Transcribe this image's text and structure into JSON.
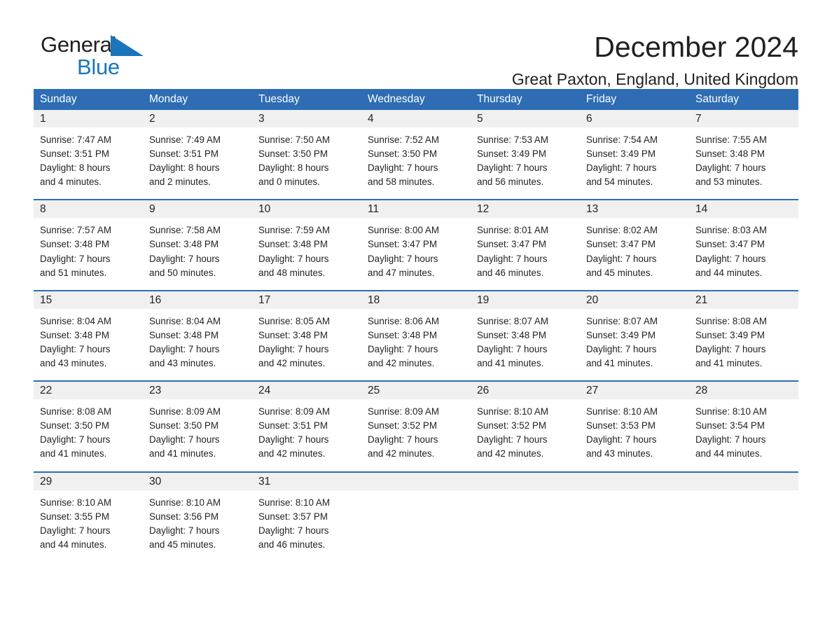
{
  "brand": {
    "name_part1": "General",
    "name_part2": "Blue",
    "triangle_color": "#1b75bb",
    "blue": "#1b75bb"
  },
  "header": {
    "title": "December 2024",
    "subtitle": "Great Paxton, England, United Kingdom"
  },
  "theme": {
    "header_blue": "#2e6db4",
    "daynum_band": "#f0f0f0",
    "text": "#231f20"
  },
  "calendar": {
    "weekdays": [
      "Sunday",
      "Monday",
      "Tuesday",
      "Wednesday",
      "Thursday",
      "Friday",
      "Saturday"
    ],
    "weeks": [
      [
        {
          "day": "1",
          "lines": [
            "Sunrise: 7:47 AM",
            "Sunset: 3:51 PM",
            "Daylight: 8 hours",
            "and 4 minutes."
          ]
        },
        {
          "day": "2",
          "lines": [
            "Sunrise: 7:49 AM",
            "Sunset: 3:51 PM",
            "Daylight: 8 hours",
            "and 2 minutes."
          ]
        },
        {
          "day": "3",
          "lines": [
            "Sunrise: 7:50 AM",
            "Sunset: 3:50 PM",
            "Daylight: 8 hours",
            "and 0 minutes."
          ]
        },
        {
          "day": "4",
          "lines": [
            "Sunrise: 7:52 AM",
            "Sunset: 3:50 PM",
            "Daylight: 7 hours",
            "and 58 minutes."
          ]
        },
        {
          "day": "5",
          "lines": [
            "Sunrise: 7:53 AM",
            "Sunset: 3:49 PM",
            "Daylight: 7 hours",
            "and 56 minutes."
          ]
        },
        {
          "day": "6",
          "lines": [
            "Sunrise: 7:54 AM",
            "Sunset: 3:49 PM",
            "Daylight: 7 hours",
            "and 54 minutes."
          ]
        },
        {
          "day": "7",
          "lines": [
            "Sunrise: 7:55 AM",
            "Sunset: 3:48 PM",
            "Daylight: 7 hours",
            "and 53 minutes."
          ]
        }
      ],
      [
        {
          "day": "8",
          "lines": [
            "Sunrise: 7:57 AM",
            "Sunset: 3:48 PM",
            "Daylight: 7 hours",
            "and 51 minutes."
          ]
        },
        {
          "day": "9",
          "lines": [
            "Sunrise: 7:58 AM",
            "Sunset: 3:48 PM",
            "Daylight: 7 hours",
            "and 50 minutes."
          ]
        },
        {
          "day": "10",
          "lines": [
            "Sunrise: 7:59 AM",
            "Sunset: 3:48 PM",
            "Daylight: 7 hours",
            "and 48 minutes."
          ]
        },
        {
          "day": "11",
          "lines": [
            "Sunrise: 8:00 AM",
            "Sunset: 3:47 PM",
            "Daylight: 7 hours",
            "and 47 minutes."
          ]
        },
        {
          "day": "12",
          "lines": [
            "Sunrise: 8:01 AM",
            "Sunset: 3:47 PM",
            "Daylight: 7 hours",
            "and 46 minutes."
          ]
        },
        {
          "day": "13",
          "lines": [
            "Sunrise: 8:02 AM",
            "Sunset: 3:47 PM",
            "Daylight: 7 hours",
            "and 45 minutes."
          ]
        },
        {
          "day": "14",
          "lines": [
            "Sunrise: 8:03 AM",
            "Sunset: 3:47 PM",
            "Daylight: 7 hours",
            "and 44 minutes."
          ]
        }
      ],
      [
        {
          "day": "15",
          "lines": [
            "Sunrise: 8:04 AM",
            "Sunset: 3:48 PM",
            "Daylight: 7 hours",
            "and 43 minutes."
          ]
        },
        {
          "day": "16",
          "lines": [
            "Sunrise: 8:04 AM",
            "Sunset: 3:48 PM",
            "Daylight: 7 hours",
            "and 43 minutes."
          ]
        },
        {
          "day": "17",
          "lines": [
            "Sunrise: 8:05 AM",
            "Sunset: 3:48 PM",
            "Daylight: 7 hours",
            "and 42 minutes."
          ]
        },
        {
          "day": "18",
          "lines": [
            "Sunrise: 8:06 AM",
            "Sunset: 3:48 PM",
            "Daylight: 7 hours",
            "and 42 minutes."
          ]
        },
        {
          "day": "19",
          "lines": [
            "Sunrise: 8:07 AM",
            "Sunset: 3:48 PM",
            "Daylight: 7 hours",
            "and 41 minutes."
          ]
        },
        {
          "day": "20",
          "lines": [
            "Sunrise: 8:07 AM",
            "Sunset: 3:49 PM",
            "Daylight: 7 hours",
            "and 41 minutes."
          ]
        },
        {
          "day": "21",
          "lines": [
            "Sunrise: 8:08 AM",
            "Sunset: 3:49 PM",
            "Daylight: 7 hours",
            "and 41 minutes."
          ]
        }
      ],
      [
        {
          "day": "22",
          "lines": [
            "Sunrise: 8:08 AM",
            "Sunset: 3:50 PM",
            "Daylight: 7 hours",
            "and 41 minutes."
          ]
        },
        {
          "day": "23",
          "lines": [
            "Sunrise: 8:09 AM",
            "Sunset: 3:50 PM",
            "Daylight: 7 hours",
            "and 41 minutes."
          ]
        },
        {
          "day": "24",
          "lines": [
            "Sunrise: 8:09 AM",
            "Sunset: 3:51 PM",
            "Daylight: 7 hours",
            "and 42 minutes."
          ]
        },
        {
          "day": "25",
          "lines": [
            "Sunrise: 8:09 AM",
            "Sunset: 3:52 PM",
            "Daylight: 7 hours",
            "and 42 minutes."
          ]
        },
        {
          "day": "26",
          "lines": [
            "Sunrise: 8:10 AM",
            "Sunset: 3:52 PM",
            "Daylight: 7 hours",
            "and 42 minutes."
          ]
        },
        {
          "day": "27",
          "lines": [
            "Sunrise: 8:10 AM",
            "Sunset: 3:53 PM",
            "Daylight: 7 hours",
            "and 43 minutes."
          ]
        },
        {
          "day": "28",
          "lines": [
            "Sunrise: 8:10 AM",
            "Sunset: 3:54 PM",
            "Daylight: 7 hours",
            "and 44 minutes."
          ]
        }
      ],
      [
        {
          "day": "29",
          "lines": [
            "Sunrise: 8:10 AM",
            "Sunset: 3:55 PM",
            "Daylight: 7 hours",
            "and 44 minutes."
          ]
        },
        {
          "day": "30",
          "lines": [
            "Sunrise: 8:10 AM",
            "Sunset: 3:56 PM",
            "Daylight: 7 hours",
            "and 45 minutes."
          ]
        },
        {
          "day": "31",
          "lines": [
            "Sunrise: 8:10 AM",
            "Sunset: 3:57 PM",
            "Daylight: 7 hours",
            "and 46 minutes."
          ]
        },
        {
          "day": "",
          "lines": []
        },
        {
          "day": "",
          "lines": []
        },
        {
          "day": "",
          "lines": []
        },
        {
          "day": "",
          "lines": []
        }
      ]
    ]
  }
}
